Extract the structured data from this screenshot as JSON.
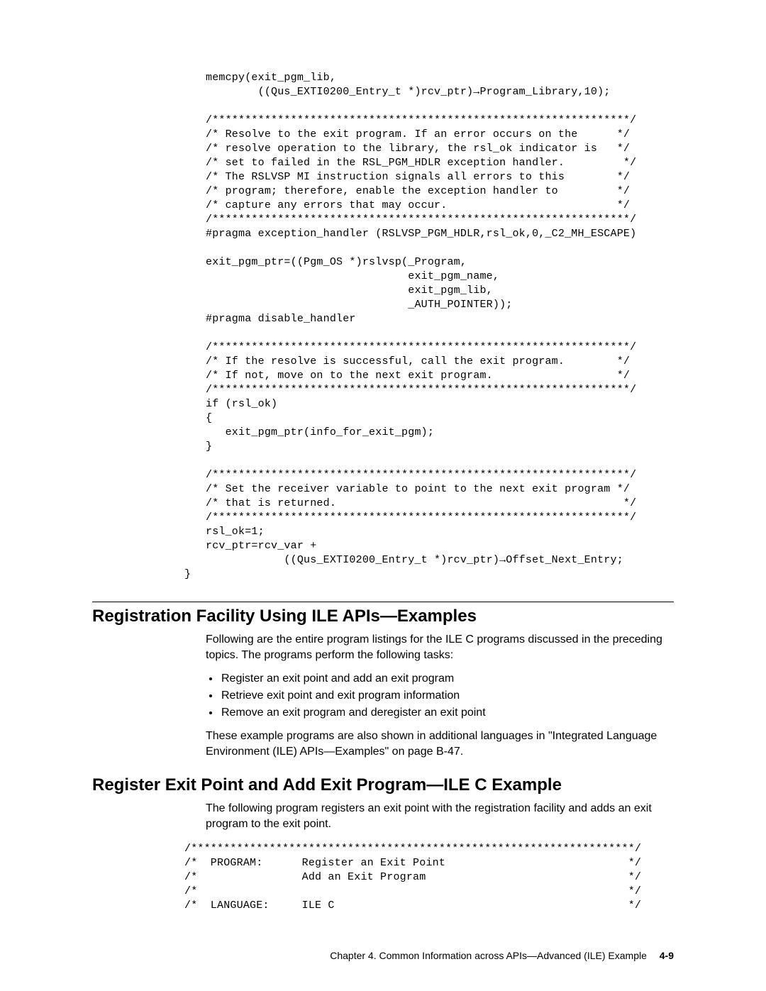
{
  "code1": "memcpy(exit_pgm_lib,\n        ((Qus_EXTI0200_Entry_t *)rcv_ptr)→Program_Library,10);\n\n/****************************************************************/\n/* Resolve to the exit program. If an error occurs on the      */\n/* resolve operation to the library, the rsl_ok indicator is   */\n/* set to failed in the RSL_PGM_HDLR exception handler.         */\n/* The RSLVSP MI instruction signals all errors to this        */\n/* program; therefore, enable the exception handler to         */\n/* capture any errors that may occur.                          */\n/****************************************************************/\n#pragma exception_handler (RSLVSP_PGM_HDLR,rsl_ok,0,_C2_MH_ESCAPE)\n\nexit_pgm_ptr=((Pgm_OS *)rslvsp(_Program,\n                               exit_pgm_name,\n                               exit_pgm_lib,\n                               _AUTH_POINTER));\n#pragma disable_handler\n\n/****************************************************************/\n/* If the resolve is successful, call the exit program.        */\n/* If not, move on to the next exit program.                   */\n/****************************************************************/\nif (rsl_ok)\n{\n   exit_pgm_ptr(info_for_exit_pgm);\n}\n\n/****************************************************************/\n/* Set the receiver variable to point to the next exit program */\n/* that is returned.                                            */\n/****************************************************************/\nrsl_ok=1;\nrcv_ptr=rcv_var +\n            ((Qus_EXTI0200_Entry_t *)rcv_ptr)→Offset_Next_Entry;",
  "code1_close": "}",
  "heading1": "Registration Facility Using ILE APIs—Examples",
  "para1": "Following are the entire program listings for the ILE C programs discussed in the preceding topics.  The programs perform the following tasks:",
  "bullets": [
    "Register an exit point and add an exit program",
    "Retrieve exit point and exit program information",
    "Remove an exit program and deregister an exit point"
  ],
  "para2": "These example programs are also shown in additional languages in \"Integrated Language Environment (ILE) APIs—Examples\" on page B-47.",
  "heading2": "Register Exit Point and Add Exit Program—ILE C Example",
  "para3": "The following program registers an exit point with the registration facility and adds an exit program to the exit point.",
  "code2": "/********************************************************************/\n/*  PROGRAM:      Register an Exit Point                            */\n/*                Add an Exit Program                               */\n/*                                                                  */\n/*  LANGUAGE:     ILE C                                             */",
  "footer_text": "Chapter 4.  Common Information across APIs—Advanced (ILE) Example",
  "footer_page": "4-9"
}
